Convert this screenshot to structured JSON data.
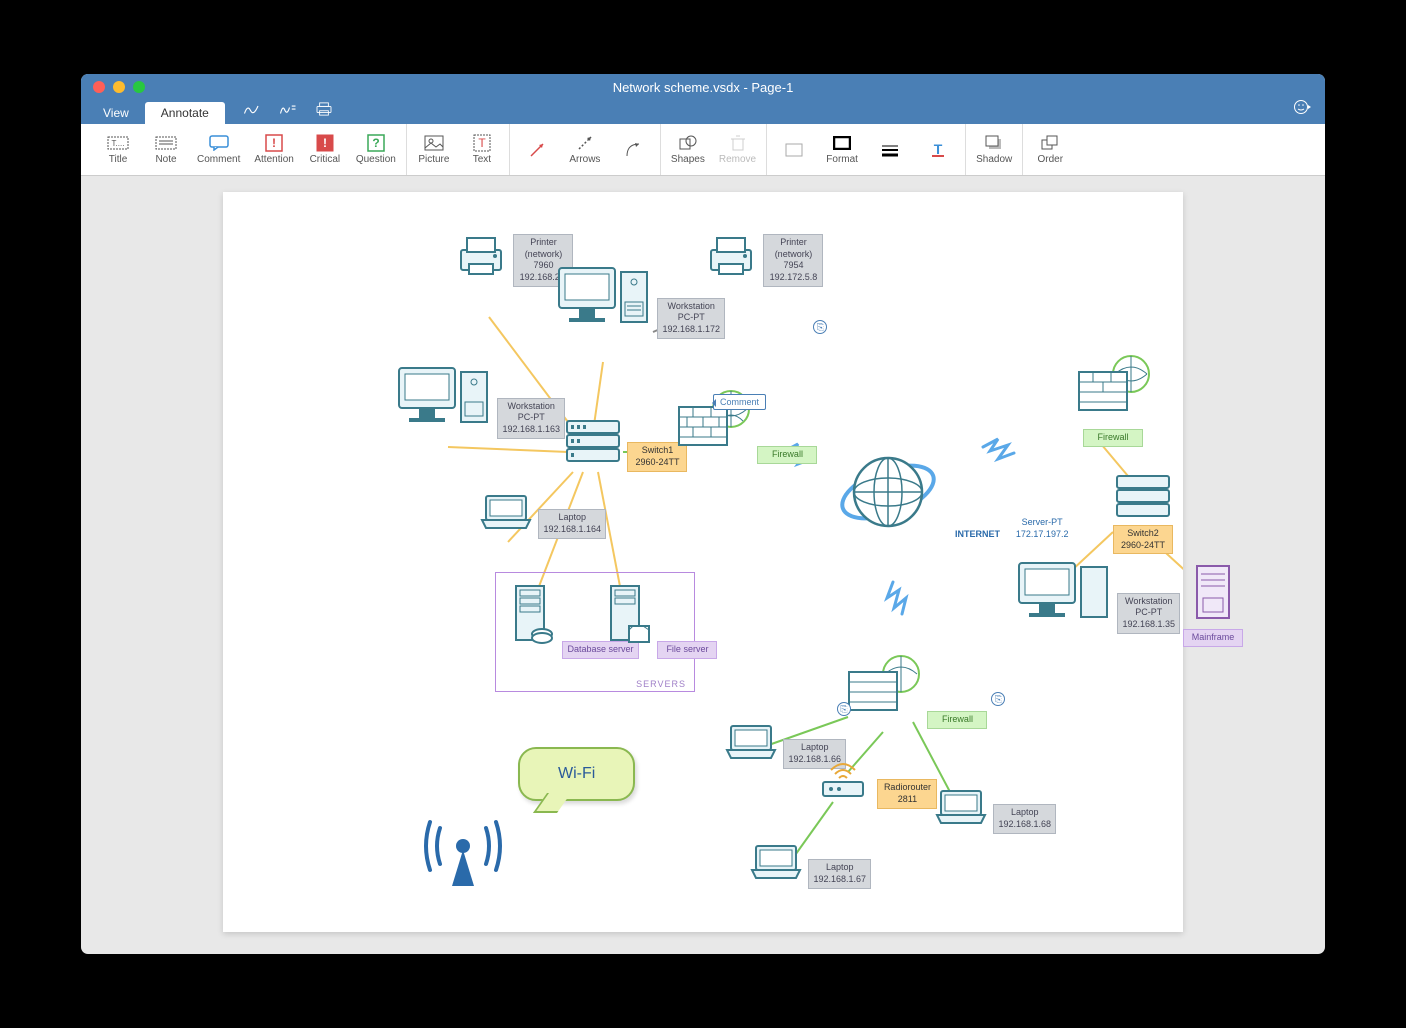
{
  "window": {
    "title": "Network scheme.vsdx - Page-1"
  },
  "tabs": {
    "view": "View",
    "annotate": "Annotate"
  },
  "toolbar": {
    "title": "Title",
    "note": "Note",
    "comment": "Comment",
    "attention": "Attention",
    "critical": "Critical",
    "question": "Question",
    "picture": "Picture",
    "text": "Text",
    "arrows": "Arrows",
    "shapes": "Shapes",
    "remove": "Remove",
    "format": "Format",
    "shadow": "Shadow",
    "order": "Order"
  },
  "nodes": {
    "printer1": {
      "name": "Printer",
      "sub": "(network)",
      "id": "7960",
      "ip": "192.168.2.8"
    },
    "printer2": {
      "name": "Printer",
      "sub": "(network)",
      "id": "7954",
      "ip": "192.172.5.8"
    },
    "ws1": {
      "name": "Workstation",
      "sub": "PC-PT",
      "ip": "192.168.1.172"
    },
    "ws2": {
      "name": "Workstation",
      "sub": "PC-PT",
      "ip": "192.168.1.163"
    },
    "ws3": {
      "name": "Workstation",
      "sub": "PC-PT",
      "ip": "192.168.1.35"
    },
    "switch1": {
      "name": "Switch1",
      "model": "2960-24TT"
    },
    "switch2": {
      "name": "Switch2",
      "model": "2960-24TT"
    },
    "fw1": {
      "name": "Firewall"
    },
    "fw2": {
      "name": "Firewall"
    },
    "fw3": {
      "name": "Firewall"
    },
    "internet": {
      "name": "INTERNET",
      "sub": "Server-PT",
      "ip": "172.17.197.2"
    },
    "laptop1": {
      "name": "Laptop",
      "ip": "192.168.1.164"
    },
    "laptop2": {
      "name": "Laptop",
      "ip": "192.168.1.66"
    },
    "laptop3": {
      "name": "Laptop",
      "ip": "192.168.1.67"
    },
    "laptop4": {
      "name": "Laptop",
      "ip": "192.168.1.68"
    },
    "dbserver": {
      "name": "Database server"
    },
    "fileserver": {
      "name": "File server"
    },
    "mainframe": {
      "name": "Mainframe"
    },
    "radiorouter": {
      "name": "Radiorouter",
      "model": "2811"
    },
    "servers_group": "SERVERS"
  },
  "annotations": {
    "comment": "Comment",
    "wifi": "Wi-Fi"
  }
}
